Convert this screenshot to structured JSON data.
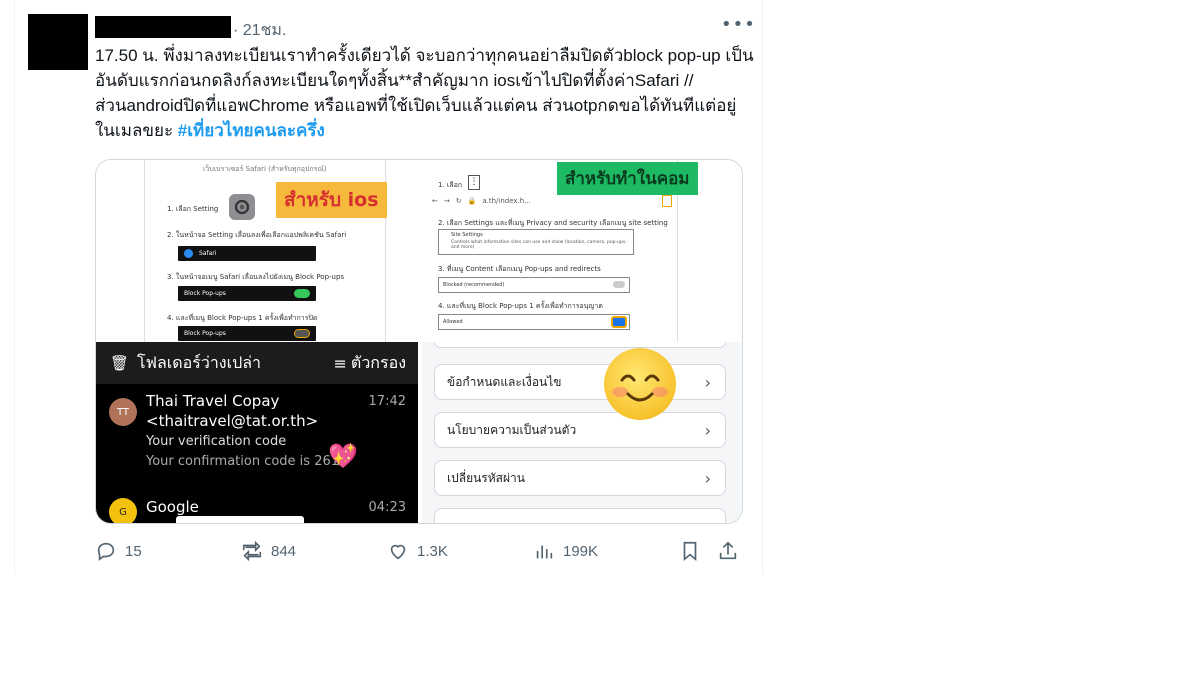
{
  "tweet": {
    "time": "· 21ชม.",
    "more": "•••",
    "text_main": "17.50 น. พึ่งมาลงทะเบียนเราทำครั้งเดียวได้ จะบอกว่าทุกคนอย่าลืมปิดตัวblock pop-up เป็นอันดับแรกก่อนกดลิงก์ลงทะเบียนใดๆทั้งสิ้น**สำคัญมาก iosเข้าไปปิดที่ตั้งค่าSafari //ส่วนandroidปิดที่แอพChrome หรือแอพที่ใช้เปิดเว็บแล้วแต่คน ส่วนotpกดขอได้ทันทีแต่อยู่ในเมลขยะ ",
    "hashtag": "#เที่ยวไทยคนละครึ่ง"
  },
  "media": {
    "ios_guide": {
      "header": "เว็บเบราเซอร์ Safari (สำหรับทุกอุปกรณ์)",
      "label": "สำหรับ ios",
      "step1": "1. เลือก Setting",
      "step2": "2. ในหน้าจอ Setting เลื่อนลงเพื่อเลือกแอปพลิเคชัน Safari",
      "safari_row": "Safari",
      "step3": "3. ในหน้าจอเมนู Safari เลื่อนลงไปยังเมนู Block Pop-ups",
      "block_row": "Block Pop-ups",
      "step4": "4. และที่เมนู Block Pop-ups 1 ครั้งเพื่อทำการปิด",
      "block_row2": "Block Pop-ups"
    },
    "pc_guide": {
      "label": "สำหรับทำในคอม",
      "step1": "1. เลือก",
      "url": "a.th/index.h...",
      "step2": "2. เลือก Settings และที่เมนู Privacy and security เลือกเมนู site setting",
      "site_settings": "Site Settings",
      "site_settings_desc": "Controls what information sites can use and show (location, camera, pop-ups, and more)",
      "step3": "3. ที่เมนู Content เลือกเมนู Pop-ups and redirects",
      "blocked": "Blocked (recommended)",
      "step4": "4. และที่เมนู Block Pop-ups 1 ครั้งเพื่อทำการอนุญาต",
      "allowed": "Allowed"
    },
    "email": {
      "folder_title": "โฟลเดอร์ว่างเปล่า",
      "filter": "ตัวกรอง",
      "items": [
        {
          "initials": "TT",
          "sender": "Thai Travel Copay",
          "address": "<thaitravel@tat.or.th>",
          "time": "17:42",
          "subject": "Your verification code",
          "preview": "Your confirmation code is 261"
        },
        {
          "initials": "G",
          "sender": "Google",
          "time": "04:23"
        }
      ]
    },
    "settings": {
      "options": [
        "ข้อกำหนดและเงื่อนไข",
        "นโยบายความเป็นส่วนตัว",
        "เปลี่ยนรหัสผ่าน"
      ]
    }
  },
  "actions": {
    "replies": "15",
    "retweets": "844",
    "likes": "1.3K",
    "views": "199K"
  },
  "colors": {
    "hashtag": "#1d9bf0",
    "muted": "#536471",
    "ios_label_bg": "#f6b93b",
    "pc_label_bg": "#1dba63"
  }
}
